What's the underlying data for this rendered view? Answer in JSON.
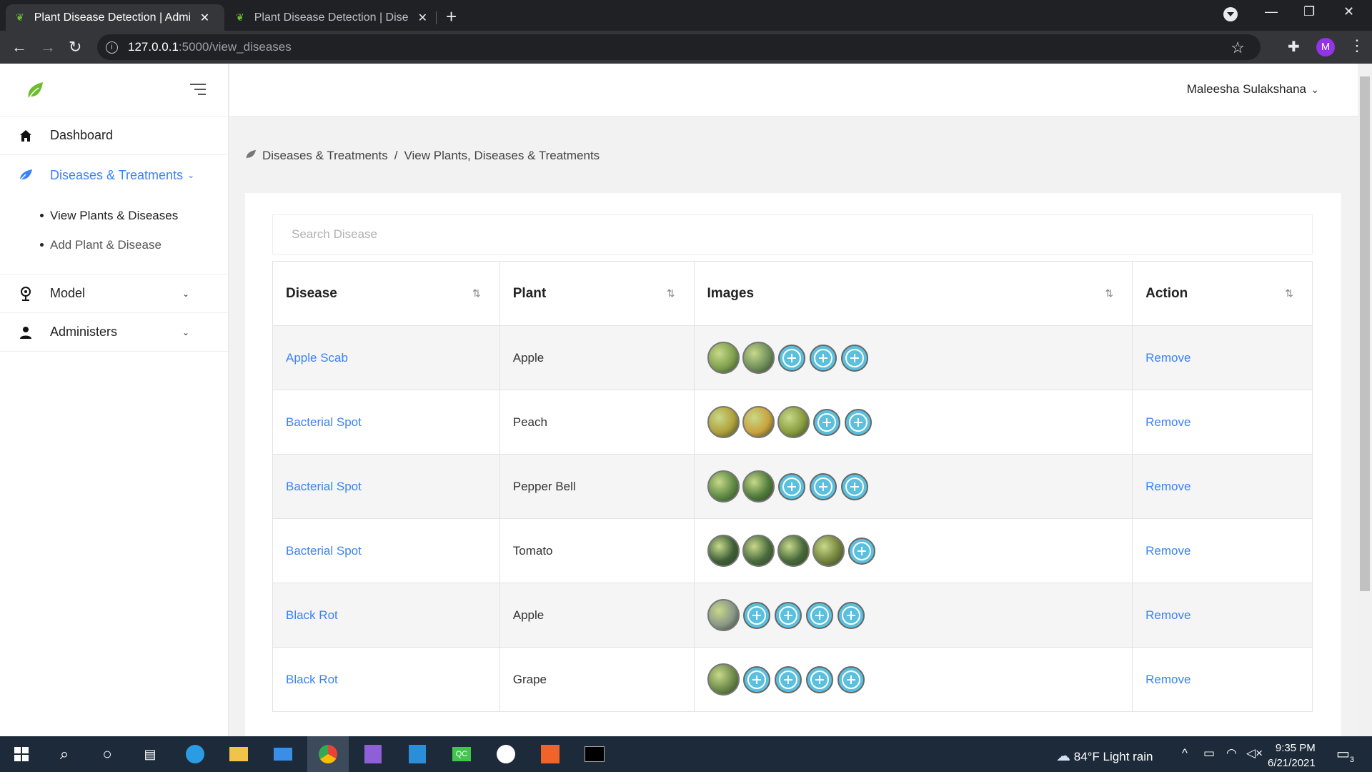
{
  "browser": {
    "tabs": [
      {
        "title": "Plant Disease Detection | Admin D",
        "close": "✕"
      },
      {
        "title": "Plant Disease Detection | Disease",
        "close": "✕"
      }
    ],
    "new_tab": "+",
    "url_host": "127.0.0.1",
    "url_path": ":5000/view_diseases",
    "avatar_letter": "M"
  },
  "sidebar": {
    "items": [
      {
        "label": "Dashboard",
        "icon": "home-icon"
      },
      {
        "label": "Diseases & Treatments",
        "icon": "leaf-icon",
        "chev": "⌄"
      },
      {
        "label": "Model",
        "icon": "webcam-icon",
        "chev": "⌄"
      },
      {
        "label": "Administers",
        "icon": "user-icon",
        "chev": "⌄"
      }
    ],
    "sub_items": [
      "View Plants & Diseases",
      "Add Plant & Disease"
    ]
  },
  "topbar": {
    "user_name": "Maleesha Sulakshana",
    "chev": "⌄"
  },
  "breadcrumb": {
    "section": "Diseases & Treatments",
    "separator": "/",
    "current": "View Plants, Diseases & Treatments"
  },
  "search": {
    "placeholder": "Search Disease"
  },
  "table": {
    "headers": [
      "Disease",
      "Plant",
      "Images",
      "Action"
    ],
    "sort_glyph": "⇅",
    "rows": [
      {
        "disease": "Apple Scab",
        "plant": "Apple",
        "thumbs": [
          "#7ea04e",
          "#6f8f5a"
        ],
        "plus": 3,
        "action": "Remove"
      },
      {
        "disease": "Bacterial Spot",
        "plant": "Peach",
        "thumbs": [
          "#b0a03a",
          "#c9a23c",
          "#8a9c3e"
        ],
        "plus": 2,
        "action": "Remove"
      },
      {
        "disease": "Bacterial Spot",
        "plant": "Pepper Bell",
        "thumbs": [
          "#5f8a44",
          "#4f7b3a"
        ],
        "plus": 3,
        "action": "Remove"
      },
      {
        "disease": "Bacterial Spot",
        "plant": "Tomato",
        "thumbs": [
          "#3f5f38",
          "#4a6b3e",
          "#47683a",
          "#74823d"
        ],
        "plus": 1,
        "action": "Remove"
      },
      {
        "disease": "Black Rot",
        "plant": "Apple",
        "thumbs": [
          "#8a9688"
        ],
        "plus": 4,
        "action": "Remove"
      },
      {
        "disease": "Black Rot",
        "plant": "Grape",
        "thumbs": [
          "#6d8a4a"
        ],
        "plus": 4,
        "action": "Remove"
      }
    ]
  },
  "taskbar": {
    "weather": "84°F  Light rain",
    "time": "9:35 PM",
    "date": "6/21/2021",
    "notifications": "3"
  }
}
